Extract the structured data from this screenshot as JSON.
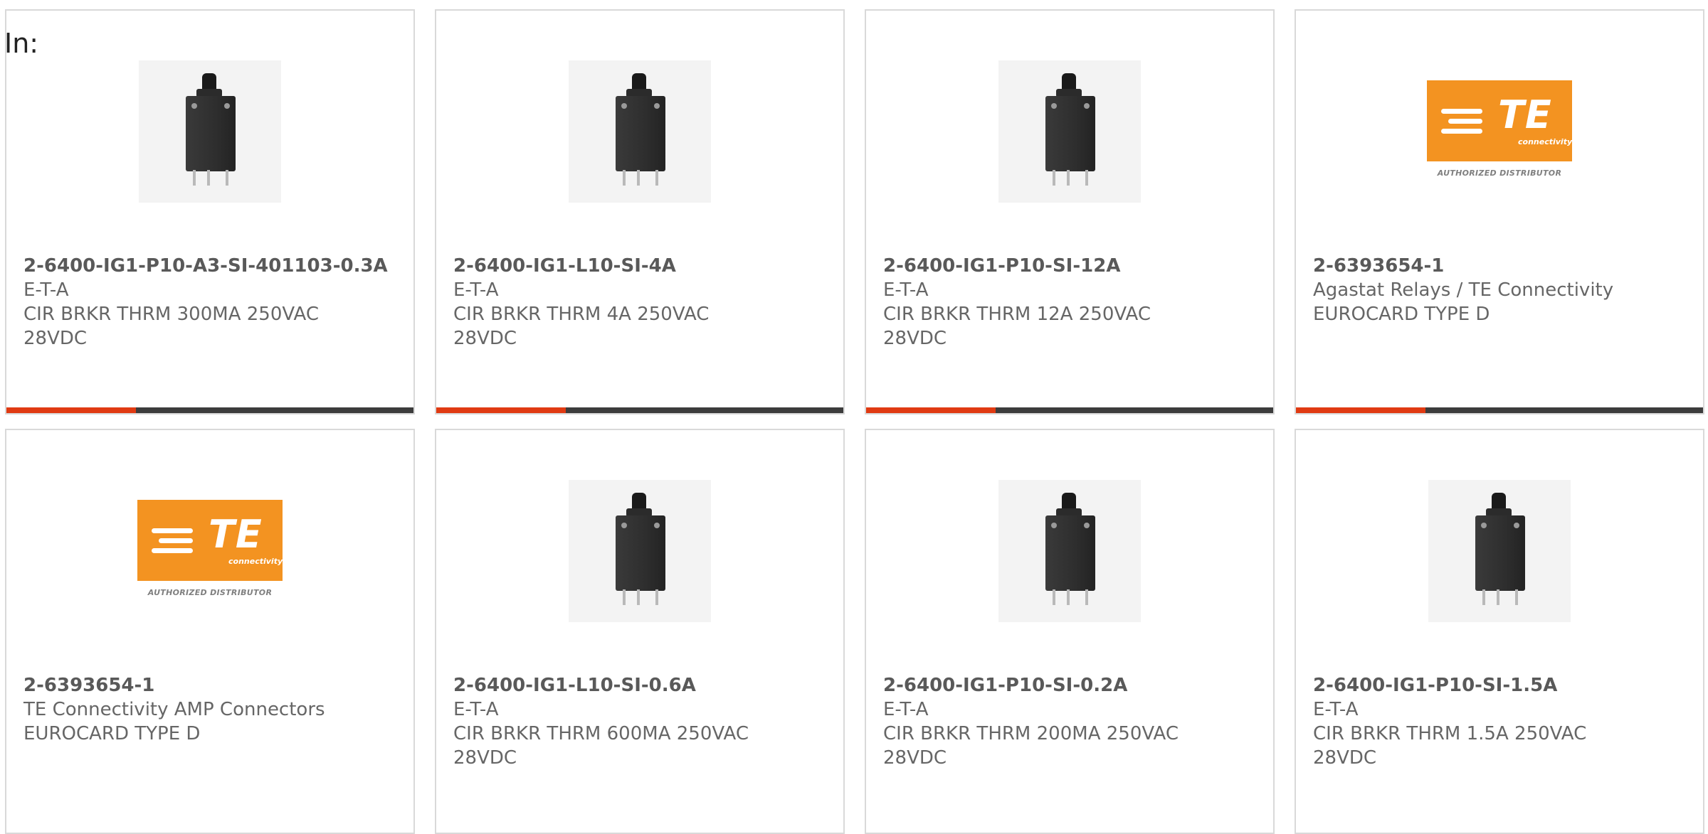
{
  "header": {
    "in_label": "In:"
  },
  "products": [
    {
      "image": "circuit-breaker-image",
      "part_number": "2-6400-IG1-P10-A3-SI-401103-0.3A",
      "manufacturer": "E-T-A",
      "description": "CIR BRKR THRM 300MA 250VAC 28VDC"
    },
    {
      "image": "circuit-breaker-image",
      "part_number": "2-6400-IG1-L10-SI-4A",
      "manufacturer": "E-T-A",
      "description": "CIR BRKR THRM 4A 250VAC 28VDC"
    },
    {
      "image": "circuit-breaker-image",
      "part_number": "2-6400-IG1-P10-SI-12A",
      "manufacturer": "E-T-A",
      "description": "CIR BRKR THRM 12A 250VAC 28VDC"
    },
    {
      "image": "te-connectivity-logo",
      "part_number": "2-6393654-1",
      "manufacturer": "Agastat Relays / TE Connectivity",
      "description": "EUROCARD TYPE D",
      "logo_text": "TE",
      "logo_subtext": "connectivity",
      "logo_caption": "AUTHORIZED DISTRIBUTOR"
    },
    {
      "image": "te-connectivity-logo",
      "part_number": "2-6393654-1",
      "manufacturer": "TE Connectivity AMP Connectors",
      "description": "EUROCARD TYPE D",
      "logo_text": "TE",
      "logo_subtext": "connectivity",
      "logo_caption": "AUTHORIZED DISTRIBUTOR"
    },
    {
      "image": "circuit-breaker-image",
      "part_number": "2-6400-IG1-L10-SI-0.6A",
      "manufacturer": "E-T-A",
      "description": "CIR BRKR THRM 600MA 250VAC 28VDC"
    },
    {
      "image": "circuit-breaker-image",
      "part_number": "2-6400-IG1-P10-SI-0.2A",
      "manufacturer": "E-T-A",
      "description": "CIR BRKR THRM 200MA 250VAC 28VDC"
    },
    {
      "image": "circuit-breaker-image",
      "part_number": "2-6400-IG1-P10-SI-1.5A",
      "manufacturer": "E-T-A",
      "description": "CIR BRKR THRM 1.5A 250VAC 28VDC"
    }
  ],
  "colors": {
    "accent": "#e03a12",
    "bar": "#3c3c3c",
    "te_orange": "#f39321",
    "border": "#d9d9d9",
    "text": "#666666"
  }
}
